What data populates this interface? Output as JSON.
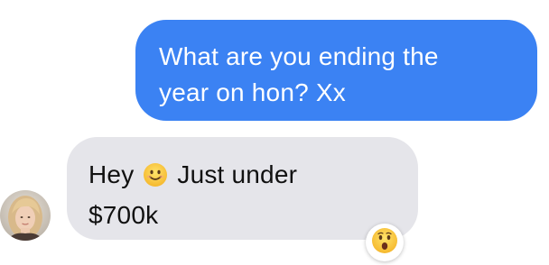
{
  "messages": {
    "sent": {
      "line1": "What are you ending the",
      "line2": "year on hon? Xx"
    },
    "received": {
      "line1_before": "Hey",
      "line1_emoji": "smiling-face-emoji",
      "line1_after": "Just under",
      "line2": "$700k",
      "reaction": "astonished-face-emoji"
    }
  },
  "colors": {
    "sent_bubble": "#3b82f3",
    "received_bubble": "#e5e5ea"
  },
  "contact": {
    "avatar": "contact-avatar-photo"
  }
}
